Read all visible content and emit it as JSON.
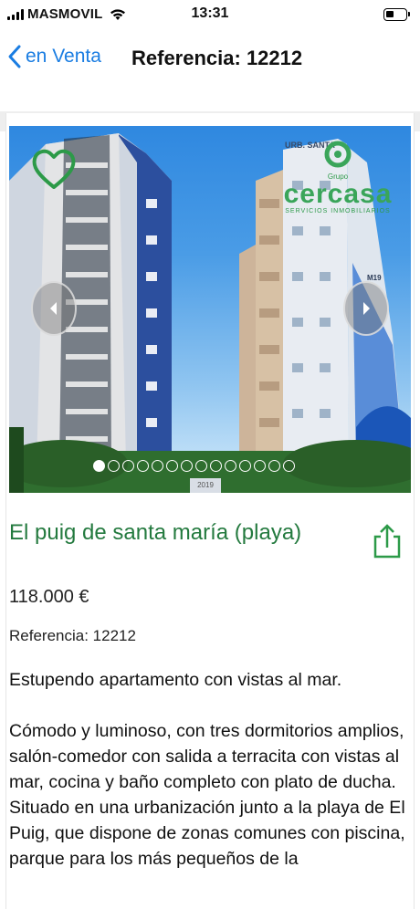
{
  "status_bar": {
    "carrier": "MASMOVIL",
    "time": "13:31"
  },
  "nav": {
    "back_label": "en Venta",
    "title": "Referencia: 12212"
  },
  "gallery": {
    "logo": {
      "group": "Grupo",
      "name": "cercasa",
      "tagline": "SERVICIOS INMOBILIARIOS"
    },
    "building_sign": "URB. SANTA",
    "tower_mark": "M19",
    "plate": "2019",
    "dots": [
      {
        "active": true
      },
      {
        "active": false
      },
      {
        "active": false
      },
      {
        "active": false
      },
      {
        "active": false
      },
      {
        "active": false
      },
      {
        "active": false
      },
      {
        "active": false
      },
      {
        "active": false
      },
      {
        "active": false
      },
      {
        "active": false
      },
      {
        "active": false
      },
      {
        "active": false
      },
      {
        "active": false
      }
    ]
  },
  "listing": {
    "title": "El puig de santa maría (playa)",
    "price": "118.000 €",
    "reference": "Referencia: 12212",
    "description": [
      "Estupendo apartamento con vistas al mar.",
      "",
      "Cómodo y luminoso, con tres dormitorios amplios, salón-comedor con salida a terracita con vistas al mar, cocina y baño completo con plato de ducha.",
      "Situado en una urbanización junto a la playa de El Puig, que dispone de zonas comunes con piscina, parque para los más pequeños de la"
    ]
  },
  "colors": {
    "accent_blue": "#1a7de2",
    "brand_green": "#247a3f"
  },
  "icons": {
    "favorite": "heart-outline-icon",
    "share": "share-icon",
    "prev": "chevron-left-icon",
    "next": "chevron-right-icon"
  }
}
